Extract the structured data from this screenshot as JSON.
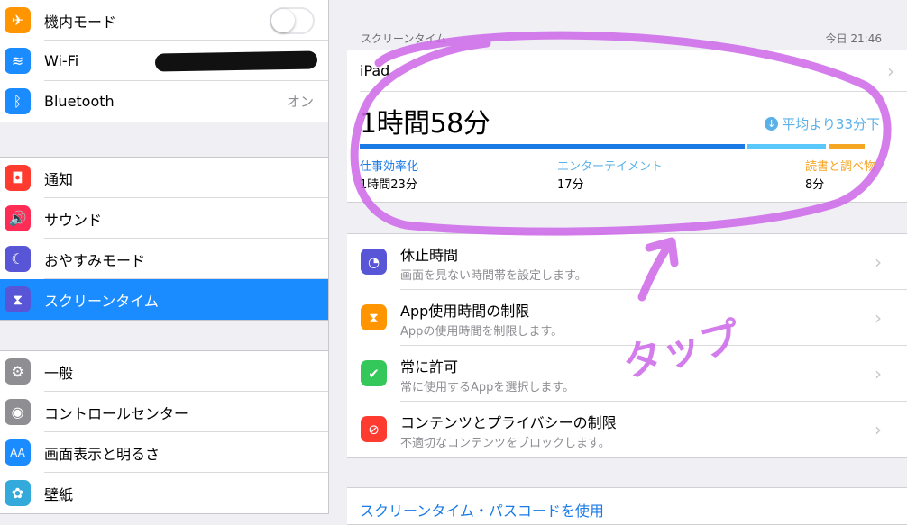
{
  "sidebar": {
    "group1": [
      {
        "icon": "airplane-icon",
        "glyph": "✈",
        "color": "#ff9500",
        "label": "機内モード",
        "toggle": false
      },
      {
        "icon": "wifi-icon",
        "glyph": "≋",
        "color": "#1a8cff",
        "label": "Wi-Fi"
      },
      {
        "icon": "bluetooth-icon",
        "glyph": "ᛒ",
        "color": "#1a8cff",
        "label": "Bluetooth",
        "value": "オン"
      }
    ],
    "group2": [
      {
        "icon": "notification-icon",
        "glyph": "◘",
        "color": "#ff3b30",
        "label": "通知"
      },
      {
        "icon": "sound-icon",
        "glyph": "🔊",
        "color": "#ff2d55",
        "label": "サウンド"
      },
      {
        "icon": "moon-icon",
        "glyph": "☾",
        "color": "#5856d6",
        "label": "おやすみモード"
      },
      {
        "icon": "hourglass-icon",
        "glyph": "⧗",
        "color": "#5856d6",
        "label": "スクリーンタイム",
        "selected": true
      }
    ],
    "group3": [
      {
        "icon": "gear-icon",
        "glyph": "⚙",
        "color": "#8e8e93",
        "label": "一般"
      },
      {
        "icon": "control-center-icon",
        "glyph": "◉",
        "color": "#8e8e93",
        "label": "コントロールセンター"
      },
      {
        "icon": "display-icon",
        "glyph": "AA",
        "color": "#1a8cff",
        "label": "画面表示と明るさ"
      },
      {
        "icon": "wallpaper-icon",
        "glyph": "✿",
        "color": "#34aadc",
        "label": "壁紙"
      }
    ]
  },
  "main": {
    "section_title": "スクリーンタイム",
    "timestamp": "今日 21:46",
    "device": "iPad",
    "total_time": "1時間58分",
    "average": "平均より33分下",
    "usage_bar": [
      {
        "name": "仕事効率化",
        "time": "1時間23分",
        "fraction": 0.74,
        "color": "#1a7ae6"
      },
      {
        "name": "エンターテイメント",
        "time": "17分",
        "fraction": 0.15,
        "color": "#5ac8fa"
      },
      {
        "name": "読書と調べ物",
        "time": "8分",
        "fraction": 0.07,
        "color": "#f5a623"
      }
    ],
    "options": [
      {
        "icon": "downtime-icon",
        "glyph": "◔",
        "color": "#5856d6",
        "title": "休止時間",
        "subtitle": "画面を見ない時間帯を設定します。"
      },
      {
        "icon": "hourglass-icon",
        "glyph": "⧗",
        "color": "#ff9500",
        "title": "App使用時間の制限",
        "subtitle": "Appの使用時間を制限します。"
      },
      {
        "icon": "check-badge-icon",
        "glyph": "✔",
        "color": "#34c759",
        "title": "常に許可",
        "subtitle": "常に使用するAppを選択します。"
      },
      {
        "icon": "block-icon",
        "glyph": "⊘",
        "color": "#ff3b30",
        "title": "コンテンツとプライバシーの制限",
        "subtitle": "不適切なコンテンツをブロックします。"
      }
    ],
    "passcode_link": "スクリーンタイム・パスコードを使用"
  },
  "annotation": {
    "text": "タップ",
    "color": "#cc66e8"
  }
}
